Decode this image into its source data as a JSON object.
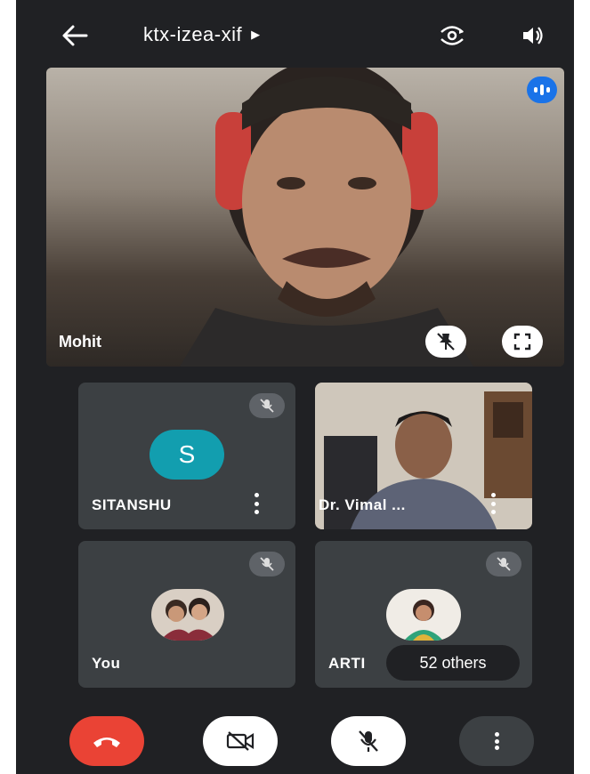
{
  "meeting": {
    "code": "ktx-izea-xif"
  },
  "main_participant": {
    "name": "Mohit"
  },
  "participants": [
    {
      "name": "SITANSHU",
      "avatar_letter": "S",
      "muted": true
    },
    {
      "name": "Dr. Vimal ...",
      "muted": true
    },
    {
      "name": "You",
      "muted": true
    },
    {
      "name": "ARTI",
      "muted": true
    }
  ],
  "others_label": "52 others",
  "colors": {
    "background": "#202124",
    "tile": "#3c4043",
    "hangup": "#ea4335",
    "avatar_teal": "#129eaf",
    "speaking_blue": "#1a73e8"
  },
  "icons": {
    "back": "arrow-left-icon",
    "meeting_info": "caret-right-icon",
    "switch_camera": "switch-camera-icon",
    "speaker": "speaker-icon",
    "pin": "unpin-icon",
    "fullscreen": "fullscreen-icon",
    "hangup": "phone-hangup-icon",
    "camera_off": "camera-off-icon",
    "mic_off": "mic-off-icon",
    "more": "more-vertical-icon"
  }
}
